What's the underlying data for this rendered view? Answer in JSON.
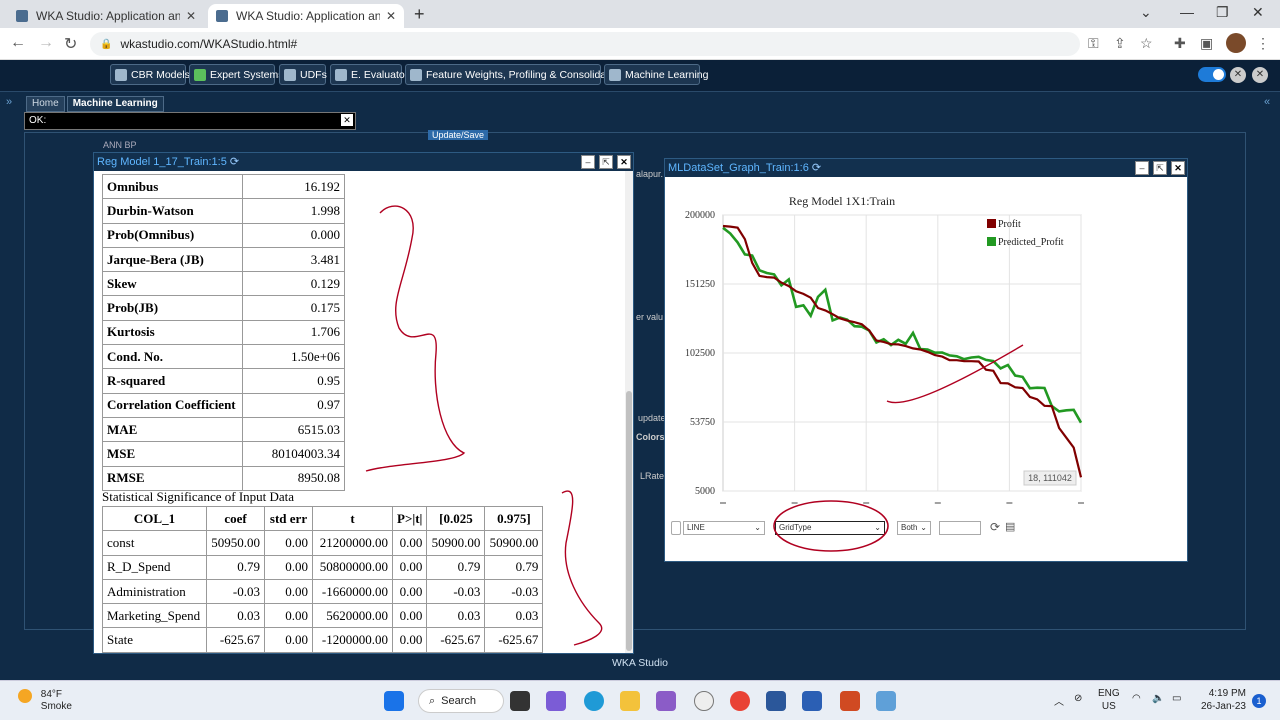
{
  "browser": {
    "tabs": [
      {
        "title": "WKA Studio: Application and sof"
      },
      {
        "title": "WKA Studio: Application and sof"
      }
    ],
    "url": "wkastudio.com/WKAStudio.html#"
  },
  "toolbar": {
    "items": [
      "CBR Models",
      "Expert Systems",
      "UDFs",
      "E. Evaluator",
      "Feature Weights, Profiling & Consolidation",
      "Machine Learning"
    ]
  },
  "subtabs": [
    "Home",
    "Machine Learning"
  ],
  "status": {
    "ok": "OK:"
  },
  "background": {
    "tree_item": "ANN BP",
    "update_save": "Update/Save",
    "frag1": "alapur.",
    "frag2": "er valu",
    "frag3": "update",
    "frag4": "Colors=",
    "frag5": "LRate"
  },
  "reg_window": {
    "title": "Reg Model 1_17_Train:1:5",
    "stats": [
      {
        "k": "Omnibus",
        "v": "16.192"
      },
      {
        "k": "Durbin-Watson",
        "v": "1.998"
      },
      {
        "k": "Prob(Omnibus)",
        "v": "0.000"
      },
      {
        "k": "Jarque-Bera (JB)",
        "v": "3.481"
      },
      {
        "k": "Skew",
        "v": "0.129"
      },
      {
        "k": "Prob(JB)",
        "v": "0.175"
      },
      {
        "k": "Kurtosis",
        "v": "1.706"
      },
      {
        "k": "Cond. No.",
        "v": "1.50e+06"
      },
      {
        "k": "R-squared",
        "v": "0.95"
      },
      {
        "k": "Correlation Coefficient",
        "v": "0.97"
      },
      {
        "k": "MAE",
        "v": "6515.03"
      },
      {
        "k": "MSE",
        "v": "80104003.34"
      },
      {
        "k": "RMSE",
        "v": "8950.08"
      }
    ],
    "sig_title": "Statistical Significance of Input Data",
    "coef_headers": [
      "COL_1",
      "coef",
      "std err",
      "t",
      "P>|t|",
      "[0.025",
      "0.975]"
    ],
    "coef_rows": [
      [
        "const",
        "50950.00",
        "0.00",
        "21200000.00",
        "0.00",
        "50900.00",
        "50900.00"
      ],
      [
        "R_D_Spend",
        "0.79",
        "0.00",
        "50800000.00",
        "0.00",
        "0.79",
        "0.79"
      ],
      [
        "Administration",
        "-0.03",
        "0.00",
        "-1660000.00",
        "0.00",
        "-0.03",
        "-0.03"
      ],
      [
        "Marketing_Spend",
        "0.03",
        "0.00",
        "5620000.00",
        "0.00",
        "0.03",
        "0.03"
      ],
      [
        "State",
        "-625.67",
        "0.00",
        "-1200000.00",
        "0.00",
        "-625.67",
        "-625.67"
      ]
    ]
  },
  "graph_window": {
    "title": "MLDataSet_Graph_Train:1:6",
    "controls": {
      "chart_type": "LINE",
      "grid_type": "GridType",
      "both": "Both"
    },
    "tooltip": "18, 111042"
  },
  "chart_data": {
    "type": "line",
    "title": "Reg Model 1X1:Train",
    "yticks": [
      200000,
      151250,
      102500,
      53750,
      5000
    ],
    "ylim": [
      5000,
      200000
    ],
    "series": [
      {
        "name": "Profit",
        "color": "#800000",
        "values": [
          192262,
          191792,
          191050,
          182902,
          166188,
          156991,
          156123,
          155753,
          152212,
          149760,
          146122,
          144259,
          141586,
          134307,
          132603,
          129917,
          126993,
          125370,
          124267,
          122776,
          118474,
          111313,
          110352,
          108734,
          108552,
          107404,
          105734,
          105008,
          103282,
          101004,
          99938,
          97484,
          97428,
          96779,
          96712,
          96479,
          90708,
          89949,
          81229,
          81006,
          78240,
          77799,
          71498,
          69759,
          65201,
          64927,
          49491,
          42560,
          35673,
          14681
        ]
      },
      {
        "name": "Predicted_Profit",
        "color": "#229922",
        "values": [
          190942,
          186918,
          180650,
          172131,
          171402,
          160939,
          159010,
          158024,
          150289,
          154514,
          135071,
          136218,
          128812,
          142216,
          147180,
          125560,
          127592,
          126010,
          121460,
          121064,
          118420,
          109900,
          112145,
          108090,
          111830,
          108990,
          116720,
          105310,
          104980,
          102690,
          102880,
          100800,
          100190,
          98090,
          99320,
          99840,
          97590,
          96750,
          91640,
          93990,
          86540,
          85640,
          77570,
          77970,
          77770,
          64970,
          61270,
          62010,
          62370,
          53260
        ]
      }
    ]
  },
  "footer": "WKA Studio",
  "taskbar": {
    "weather_temp": "84°F",
    "weather_desc": "Smoke",
    "search": "Search",
    "lang1": "ENG",
    "lang2": "US",
    "time": "4:19 PM",
    "date": "26-Jan-23",
    "notif": "1"
  }
}
